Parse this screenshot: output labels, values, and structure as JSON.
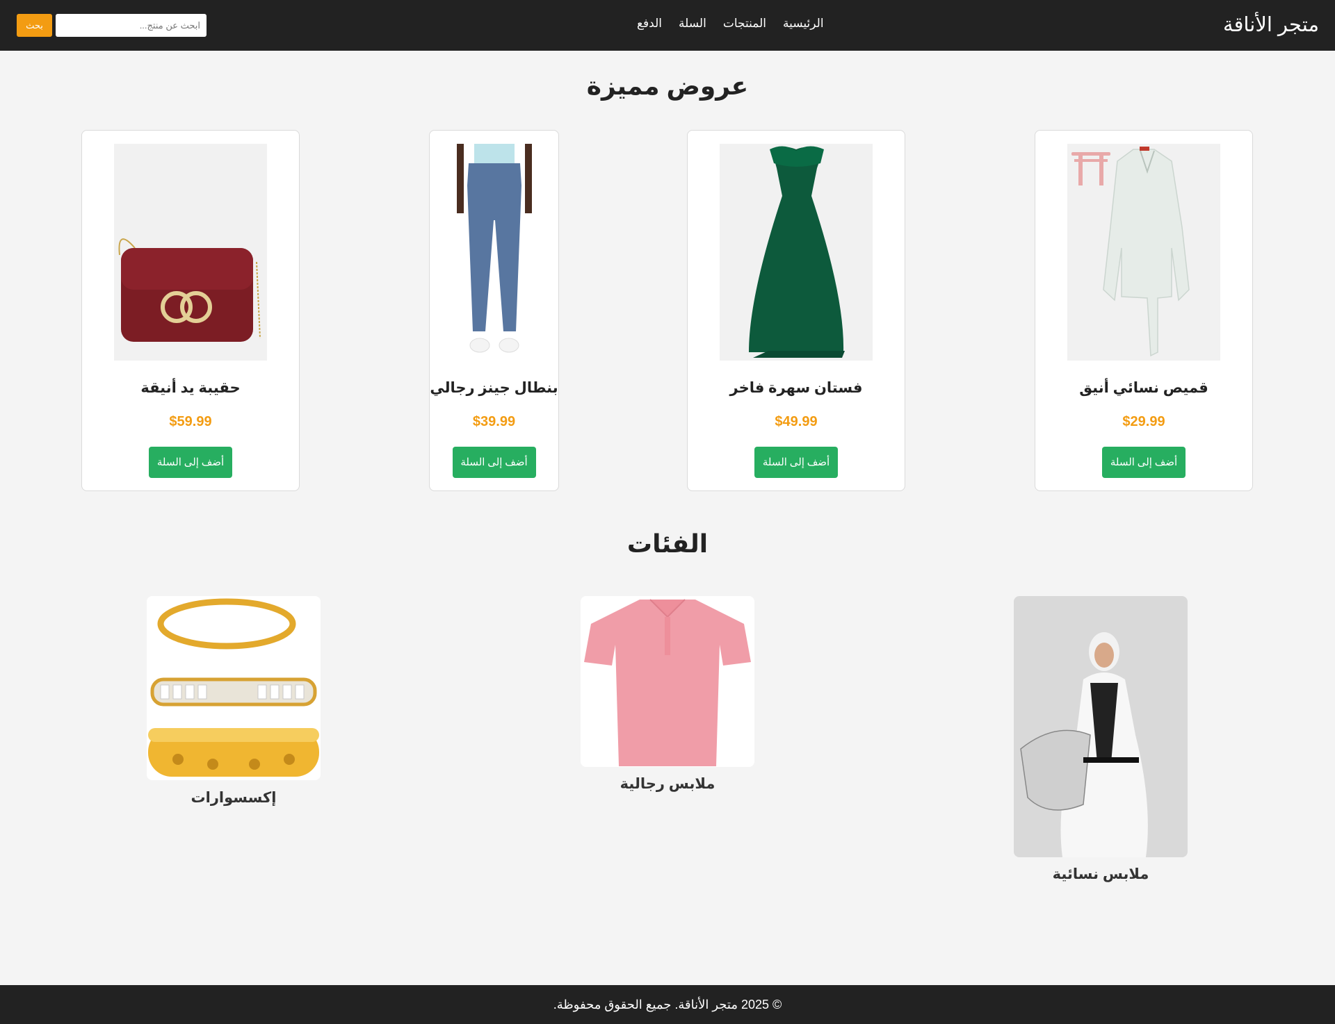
{
  "header": {
    "brand": "متجر الأناقة",
    "nav": [
      "الرئيسية",
      "المنتجات",
      "السلة",
      "الدفع"
    ],
    "search_placeholder": "ابحث عن منتج...",
    "search_button": "بحث"
  },
  "featured": {
    "title": "عروض مميزة",
    "products": [
      {
        "name": "قميص نسائي أنيق",
        "price": "$29.99",
        "add_label": "أضف إلى السلة",
        "image": "womens-blouse-image"
      },
      {
        "name": "فستان سهرة فاخر",
        "price": "$49.99",
        "add_label": "أضف إلى السلة",
        "image": "evening-dress-image"
      },
      {
        "name": "بنطال جينز رجالي",
        "price": "$39.99",
        "add_label": "أضف إلى السلة",
        "image": "mens-jeans-image"
      },
      {
        "name": "حقيبة يد أنيقة",
        "price": "$59.99",
        "add_label": "أضف إلى السلة",
        "image": "handbag-image"
      }
    ]
  },
  "categories": {
    "title": "الفئات",
    "items": [
      {
        "label": "ملابس نسائية",
        "image": "womens-clothing-image"
      },
      {
        "label": "ملابس رجالية",
        "image": "mens-clothing-image"
      },
      {
        "label": "إكسسوارات",
        "image": "accessories-image"
      }
    ]
  },
  "footer": {
    "text": "© 2025 متجر الأناقة. جميع الحقوق محفوظة."
  },
  "colors": {
    "header_bg": "#222222",
    "accent_orange": "#f39c12",
    "button_green": "#27ae60",
    "page_bg": "#f4f4f4"
  }
}
